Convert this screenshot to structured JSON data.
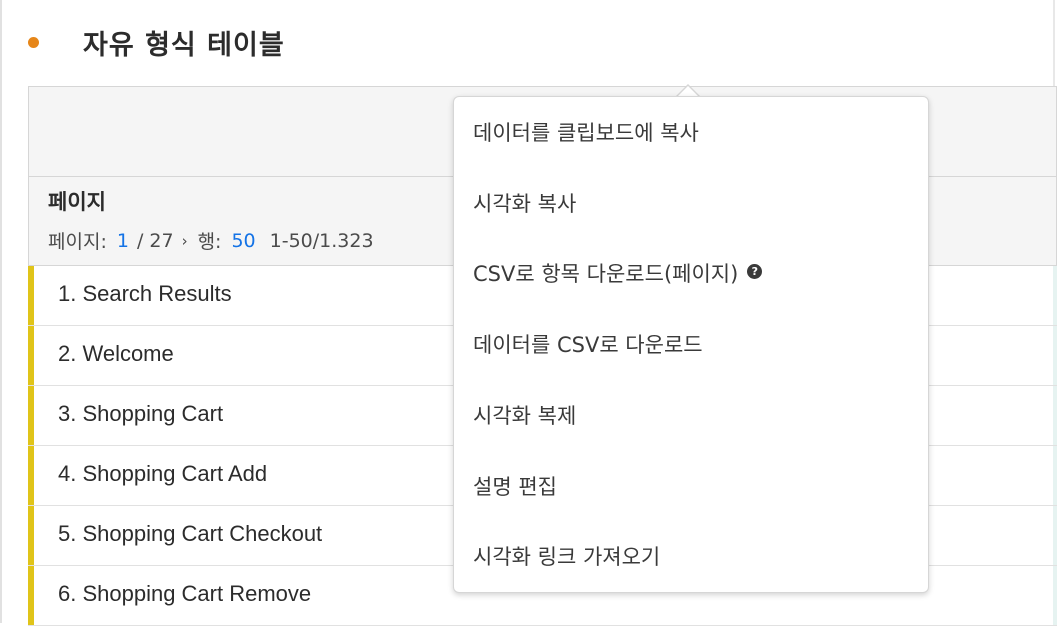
{
  "panel": {
    "title": "자유 형식 테이블"
  },
  "table": {
    "dimension_title": "페이지",
    "pager": {
      "page_label": "페이지:",
      "page_current": "1",
      "page_total": "/ 27",
      "rows_label": "행:",
      "rows_value": "50",
      "range": "1-50/1.323"
    },
    "rows": [
      "1. Search Results",
      "2. Welcome",
      "3. Shopping Cart",
      "4. Shopping Cart Add",
      "5. Shopping Cart Checkout",
      "6. Shopping Cart Remove"
    ]
  },
  "menu": {
    "items": [
      "데이터를 클립보드에 복사",
      "시각화 복사",
      "CSV로 항목 다운로드(페이지)",
      "데이터를 CSV로 다운로드",
      "시각화 복제",
      "설명 편집",
      "시각화 링크 가져오기"
    ]
  },
  "colors": {
    "accent_dot": "#e68619",
    "row_bar": "#e0c419",
    "link_blue": "#1473e6"
  },
  "icons": {
    "help": "help-circle-icon",
    "chevron": "chevron-right-icon"
  }
}
